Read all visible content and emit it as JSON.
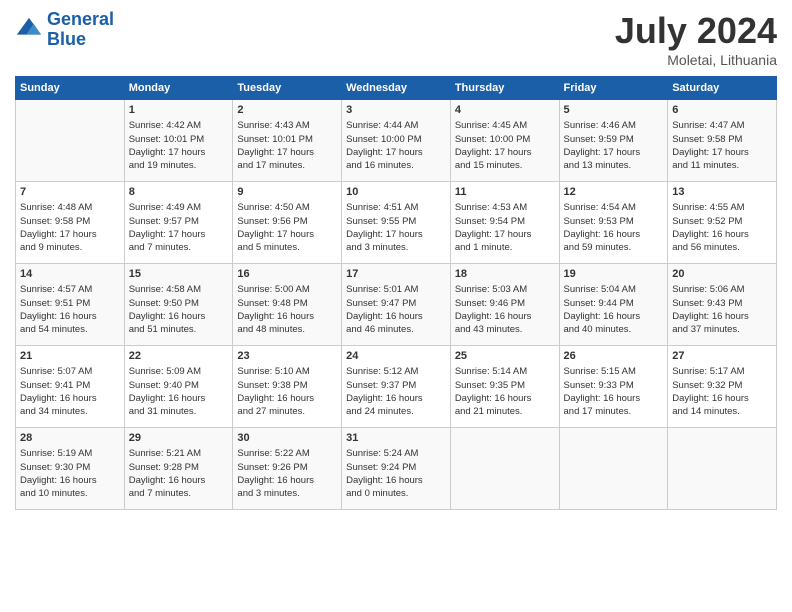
{
  "header": {
    "logo_line1": "General",
    "logo_line2": "Blue",
    "title": "July 2024",
    "location": "Moletai, Lithuania"
  },
  "columns": [
    "Sunday",
    "Monday",
    "Tuesday",
    "Wednesday",
    "Thursday",
    "Friday",
    "Saturday"
  ],
  "weeks": [
    [
      {
        "day": "",
        "content": ""
      },
      {
        "day": "1",
        "content": "Sunrise: 4:42 AM\nSunset: 10:01 PM\nDaylight: 17 hours\nand 19 minutes."
      },
      {
        "day": "2",
        "content": "Sunrise: 4:43 AM\nSunset: 10:01 PM\nDaylight: 17 hours\nand 17 minutes."
      },
      {
        "day": "3",
        "content": "Sunrise: 4:44 AM\nSunset: 10:00 PM\nDaylight: 17 hours\nand 16 minutes."
      },
      {
        "day": "4",
        "content": "Sunrise: 4:45 AM\nSunset: 10:00 PM\nDaylight: 17 hours\nand 15 minutes."
      },
      {
        "day": "5",
        "content": "Sunrise: 4:46 AM\nSunset: 9:59 PM\nDaylight: 17 hours\nand 13 minutes."
      },
      {
        "day": "6",
        "content": "Sunrise: 4:47 AM\nSunset: 9:58 PM\nDaylight: 17 hours\nand 11 minutes."
      }
    ],
    [
      {
        "day": "7",
        "content": "Sunrise: 4:48 AM\nSunset: 9:58 PM\nDaylight: 17 hours\nand 9 minutes."
      },
      {
        "day": "8",
        "content": "Sunrise: 4:49 AM\nSunset: 9:57 PM\nDaylight: 17 hours\nand 7 minutes."
      },
      {
        "day": "9",
        "content": "Sunrise: 4:50 AM\nSunset: 9:56 PM\nDaylight: 17 hours\nand 5 minutes."
      },
      {
        "day": "10",
        "content": "Sunrise: 4:51 AM\nSunset: 9:55 PM\nDaylight: 17 hours\nand 3 minutes."
      },
      {
        "day": "11",
        "content": "Sunrise: 4:53 AM\nSunset: 9:54 PM\nDaylight: 17 hours\nand 1 minute."
      },
      {
        "day": "12",
        "content": "Sunrise: 4:54 AM\nSunset: 9:53 PM\nDaylight: 16 hours\nand 59 minutes."
      },
      {
        "day": "13",
        "content": "Sunrise: 4:55 AM\nSunset: 9:52 PM\nDaylight: 16 hours\nand 56 minutes."
      }
    ],
    [
      {
        "day": "14",
        "content": "Sunrise: 4:57 AM\nSunset: 9:51 PM\nDaylight: 16 hours\nand 54 minutes."
      },
      {
        "day": "15",
        "content": "Sunrise: 4:58 AM\nSunset: 9:50 PM\nDaylight: 16 hours\nand 51 minutes."
      },
      {
        "day": "16",
        "content": "Sunrise: 5:00 AM\nSunset: 9:48 PM\nDaylight: 16 hours\nand 48 minutes."
      },
      {
        "day": "17",
        "content": "Sunrise: 5:01 AM\nSunset: 9:47 PM\nDaylight: 16 hours\nand 46 minutes."
      },
      {
        "day": "18",
        "content": "Sunrise: 5:03 AM\nSunset: 9:46 PM\nDaylight: 16 hours\nand 43 minutes."
      },
      {
        "day": "19",
        "content": "Sunrise: 5:04 AM\nSunset: 9:44 PM\nDaylight: 16 hours\nand 40 minutes."
      },
      {
        "day": "20",
        "content": "Sunrise: 5:06 AM\nSunset: 9:43 PM\nDaylight: 16 hours\nand 37 minutes."
      }
    ],
    [
      {
        "day": "21",
        "content": "Sunrise: 5:07 AM\nSunset: 9:41 PM\nDaylight: 16 hours\nand 34 minutes."
      },
      {
        "day": "22",
        "content": "Sunrise: 5:09 AM\nSunset: 9:40 PM\nDaylight: 16 hours\nand 31 minutes."
      },
      {
        "day": "23",
        "content": "Sunrise: 5:10 AM\nSunset: 9:38 PM\nDaylight: 16 hours\nand 27 minutes."
      },
      {
        "day": "24",
        "content": "Sunrise: 5:12 AM\nSunset: 9:37 PM\nDaylight: 16 hours\nand 24 minutes."
      },
      {
        "day": "25",
        "content": "Sunrise: 5:14 AM\nSunset: 9:35 PM\nDaylight: 16 hours\nand 21 minutes."
      },
      {
        "day": "26",
        "content": "Sunrise: 5:15 AM\nSunset: 9:33 PM\nDaylight: 16 hours\nand 17 minutes."
      },
      {
        "day": "27",
        "content": "Sunrise: 5:17 AM\nSunset: 9:32 PM\nDaylight: 16 hours\nand 14 minutes."
      }
    ],
    [
      {
        "day": "28",
        "content": "Sunrise: 5:19 AM\nSunset: 9:30 PM\nDaylight: 16 hours\nand 10 minutes."
      },
      {
        "day": "29",
        "content": "Sunrise: 5:21 AM\nSunset: 9:28 PM\nDaylight: 16 hours\nand 7 minutes."
      },
      {
        "day": "30",
        "content": "Sunrise: 5:22 AM\nSunset: 9:26 PM\nDaylight: 16 hours\nand 3 minutes."
      },
      {
        "day": "31",
        "content": "Sunrise: 5:24 AM\nSunset: 9:24 PM\nDaylight: 16 hours\nand 0 minutes."
      },
      {
        "day": "",
        "content": ""
      },
      {
        "day": "",
        "content": ""
      },
      {
        "day": "",
        "content": ""
      }
    ]
  ]
}
